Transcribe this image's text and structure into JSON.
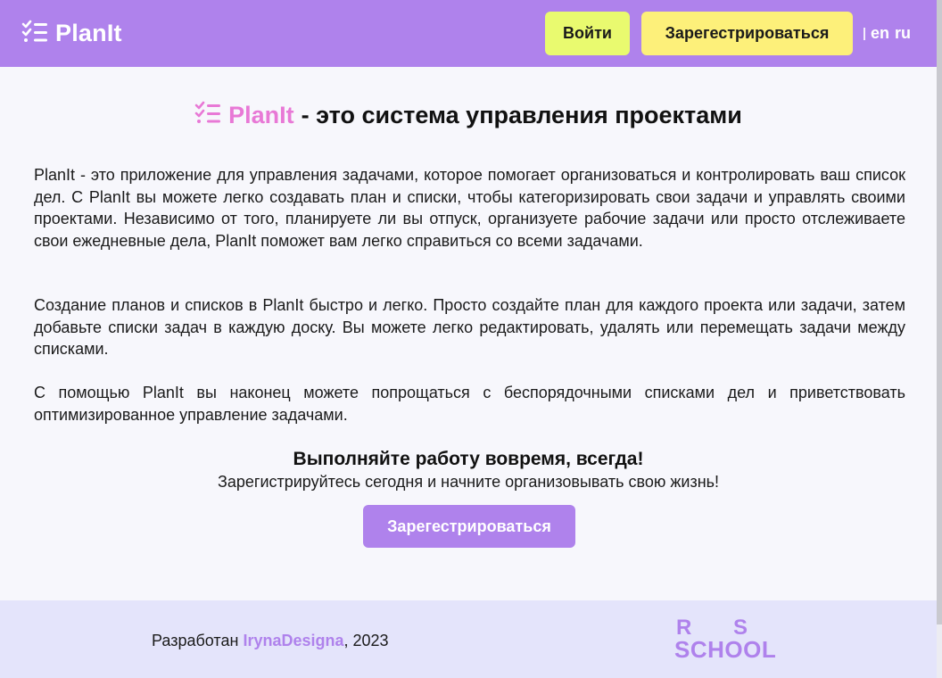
{
  "header": {
    "logo_text": "PlanIt",
    "login_label": "Войти",
    "register_label": "Зарегестрироваться",
    "lang_en": "en",
    "lang_ru": "ru"
  },
  "main": {
    "title_brand": "PlanIt",
    "title_rest": "- это система управления проектами",
    "paragraphs": [
      "PlanIt - это приложение для управления задачами, которое помогает организоваться и контролировать ваш список дел. С PlanIt вы можете легко создавать план и списки, чтобы категоризировать свои задачи и управлять своими проектами. Независимо от того, планируете ли вы отпуск, организуете рабочие задачи или просто отслеживаете свои ежедневные дела, PlanIt поможет вам легко справиться со всеми задачами.",
      "Создание планов и списков в PlanIt быстро и легко. Просто создайте план для каждого проекта или задачи, затем добавьте списки задач в каждую доску. Вы можете легко редактировать, удалять или перемещать задачи между списками.",
      "С помощью PlanIt вы наконец можете попрощаться с беспорядочными списками дел и приветствовать оптимизированное управление задачами."
    ],
    "cta_heading": "Выполняйте работу вовремя, всегда!",
    "cta_sub": "Зарегистрируйтесь сегодня и начните организовывать свою жизнь!",
    "cta_button": "Зарегестрироваться"
  },
  "footer": {
    "credit_prefix": "Разработан",
    "credit_author": "IrynaDesigna",
    "credit_suffix": ", 2023",
    "rs_r": "R",
    "rs_s": "S",
    "rs_school": "SCHOOL"
  },
  "colors": {
    "header_bg": "#af82ec",
    "login_bg": "#e9fa6f",
    "register_bg": "#fdf07a",
    "brand_pink": "#e879d6",
    "accent_purple": "#af82ec",
    "footer_bg": "#e4e4fb"
  },
  "icons": {
    "logo": "checklist-icon"
  }
}
